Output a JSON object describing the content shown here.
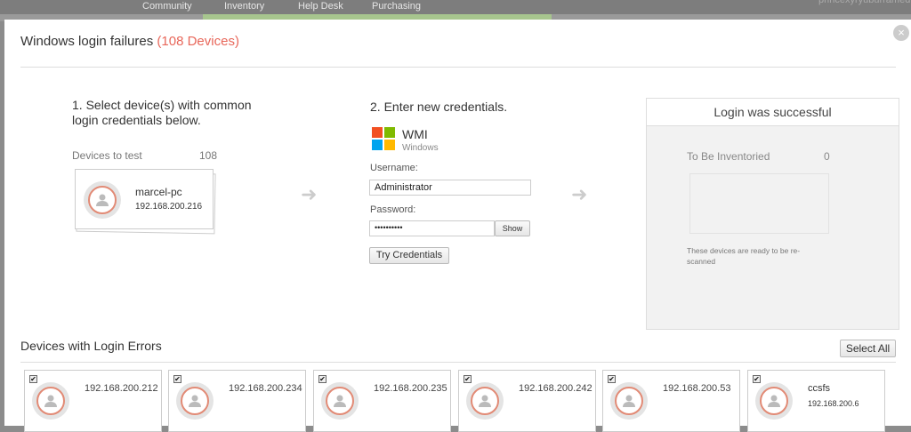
{
  "topbar": {
    "nav": [
      "Community",
      "Inventory",
      "Help Desk",
      "Purchasing"
    ],
    "user": "princexyryuburramed"
  },
  "modal": {
    "title": "Windows login failures",
    "count": "(108 Devices)"
  },
  "step1": {
    "heading_line1": "1. Select device(s) with common",
    "heading_line2": "login credentials below.",
    "devices_label": "Devices to test",
    "devices_count": "108",
    "device": {
      "name": "marcel-pc",
      "ip": "192.168.200.216"
    }
  },
  "step2": {
    "heading": "2. Enter new credentials.",
    "protocol": "WMI",
    "os": "Windows",
    "username_label": "Username:",
    "username_value": "Administrator",
    "password_label": "Password:",
    "password_value": "••••••••••",
    "show_label": "Show",
    "try_label": "Try Credentials"
  },
  "success": {
    "header": "Login was successful",
    "inventory_label": "To Be Inventoried",
    "inventory_count": "0",
    "note": "These devices are ready to be re-scanned"
  },
  "errors": {
    "title": "Devices with Login Errors",
    "select_all": "Select All",
    "devices": [
      {
        "ip": "192.168.200.212"
      },
      {
        "ip": "192.168.200.234"
      },
      {
        "ip": "192.168.200.235"
      },
      {
        "ip": "192.168.200.242"
      },
      {
        "ip": "192.168.200.53"
      },
      {
        "name": "ccsfs",
        "ip": "192.168.200.6"
      }
    ]
  }
}
